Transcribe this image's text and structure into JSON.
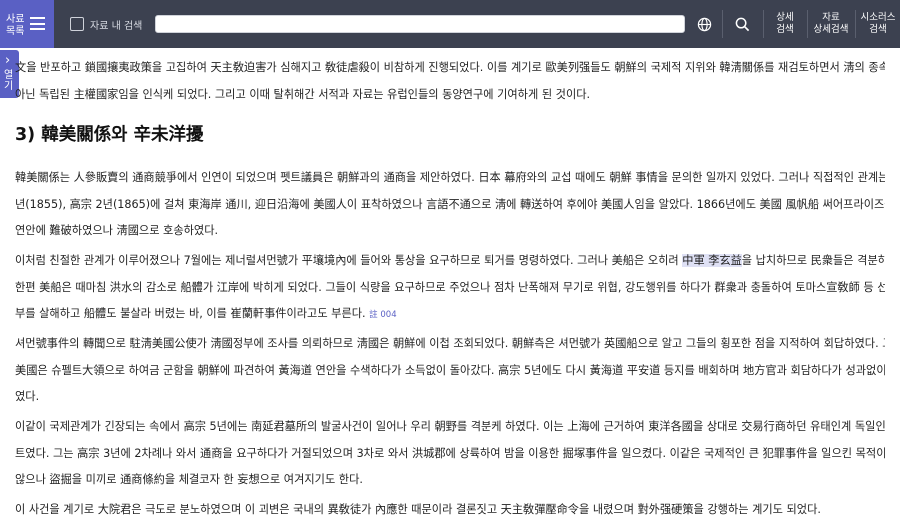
{
  "topbar": {
    "menu_label_1": "사료",
    "menu_label_2": "목록",
    "checkbox_label": "자료 내 검색",
    "search_value": "",
    "btn_detail_1": "상세",
    "btn_detail_2": "검색",
    "btn_data_1": "자료",
    "btn_data_2": "상세검색",
    "btn_thesaurus_1": "시소러스",
    "btn_thesaurus_2": "검색",
    "icons": {
      "globe": "globe-icon",
      "search": "search-icon",
      "menu": "hamburger-icon"
    }
  },
  "sidetab": {
    "chevron": "›",
    "label": "열기"
  },
  "article": {
    "p0": [
      "文을 반포하고 鎖國攘夷政策을 고집하여 天主敎迫害가 심해지고 敎徒虐殺이 비참하게 진행되었다. 이를 계기로 歐美列强들도 朝鮮의 국제적 지위와 韓淸關係를 재검토하면서 淸의 종속국가가",
      "아닌 독립된 主權國家임을 인식케 되었다. 그리고 이때 탈취해간 서적과 자료는 유럽인들의 동양연구에 기여하게 된 것이다."
    ],
    "heading": "3) 韓美關係와 辛未洋擾",
    "p1": [
      "韓美關係는 人參販賣의 通商競爭에서 인연이 되었으며 펫트議員은 朝鮮과의 通商을 제안하였다. 日本 幕府와의 교섭 때에도 朝鮮 事情을 문의한 일까지 있었다. 그러나 직접적인 관계는 哲宗 6",
      "년(1855), 高宗 2년(1865)에 걸쳐 東海岸 通川, 迎日沿海에 美國人이 표착하였으나 言語不通으로 淸에 轉送하여 후에야 美國人임을 알았다. 1866년에도 美國 風帆船 써어프라이즈號가 宣川浦",
      "연안에 難破하였으나 淸國으로 호송하였다."
    ],
    "p2": {
      "line1_a": "이처럼 친절한 관계가 이루어졌으나 7월에는 제너럴셔먼號가 平壤境內에 들어와 통상을 요구하므로 퇴거를 명령하였다. 그러나 美船은 오히려 ",
      "line1_hl": "中軍 李玄益",
      "line1_b": "을 납치하므로 民衆들은 격분하였다.",
      "line2": "한편 美船은 때마침 洪水의 감소로 船體가 江岸에 박히게 되었다. 그들이 식량을 요구하므로 주었으나 점차 난폭해져 무기로 위협, 강도행위를 하다가 群衆과 충돌하여 토마스宣敎師 등 선원 전",
      "line3": "부를 살해하고 船體도 불살라 버렸는 바, 이를 崔蘭軒事件이라고도 부른다.",
      "note": "註 004"
    },
    "p3": [
      "셔먼號事件의 轉聞으로 駐淸美國公使가 淸國정부에 조사를 의뢰하므로 淸國은 朝鮮에 이첩 조회되었다. 朝鮮측은 셔먼號가 英國船으로 알고 그들의 횡포한 점을 지적하여 회답하였다. 그러자",
      "美國은 슈펠트大領으로 하여금 군함을 朝鮮에 파견하여 黃海道 연안을 수색하다가 소득없이 돌아갔다. 高宗 5년에도 다시 黃海道 平安道 등지를 배회하며 地方官과 회담하다가 성과없이 퇴거하",
      "였다."
    ],
    "p4": [
      "이같이 국제관계가 긴장되는 속에서 高宗 5년에는 南延君墓所의 발굴사건이 일어나 우리 朝野를 격분케 하였다. 이는 上海에 근거하여 東洋各國을 상대로 交易行商하던 유태인계 독일인 오페르",
      "트였다. 그는 高宗 3년에 2차례나 와서 通商을 요구하다가 거절되었으며 3차로 와서 洪城郡에 상륙하여 밤을 이용한 掘塚事件을 일으켰다. 이같은 국제적인 큰 犯罪事件을 일으킨 목적이 확실치",
      "않으나 盜掘을 미끼로 通商條約을 체결코자 한 妄想으로 여겨지기도 한다."
    ],
    "p5": [
      "이 사건을 계기로 大院君은 극도로 분노하였으며 이 괴변은 국내의 異敎徒가 內應한 때문이라 결론짓고 天主敎彈壓命令을 내렸으며 對外强硬策을 강행하는 계기도 되었다."
    ]
  }
}
